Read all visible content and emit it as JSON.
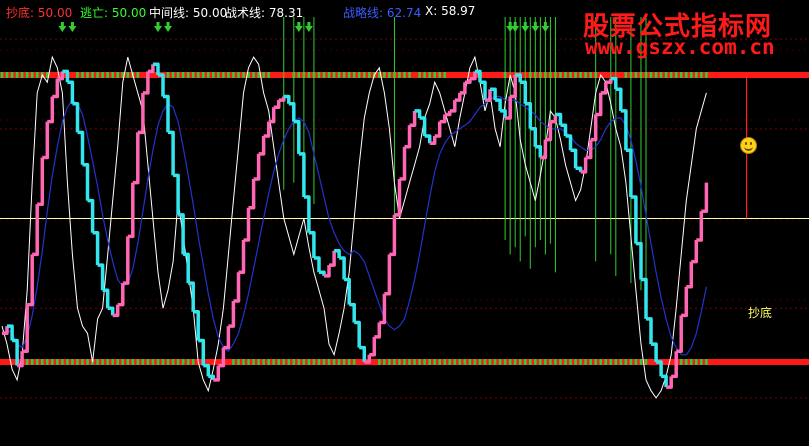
{
  "legend": {
    "chaodi": {
      "label": "抄底: ",
      "value": "50.00",
      "color": "#ff3030"
    },
    "taowang": {
      "label": "逃亡: ",
      "value": "50.00",
      "color": "#33ff33"
    },
    "zhongjian": {
      "label": "中间线: ",
      "value": "50.00",
      "color": "#ffffff"
    },
    "zhanshu": {
      "label": "战术线: ",
      "value": "78.31",
      "color": "#ffffff"
    },
    "zhanlue": {
      "label": "战略线: ",
      "value": "62.74",
      "color": "#3a5cff"
    },
    "x": {
      "label": "X: ",
      "value": "58.97",
      "color": "#ffffff"
    }
  },
  "watermark": {
    "line1": "股票公式指标网",
    "line2": "www.gszx.com.cn"
  },
  "annotation": {
    "text": "抄底",
    "color": "#ffff66"
  },
  "colors": {
    "tactical_up": "#ff66b3",
    "tactical_down": "#33e6ee",
    "strategic": "#2233cc",
    "x_line": "#ffffff",
    "band": "#ff1a1a",
    "band_green": "#33cc33",
    "middle": "#ffffaa",
    "signal_green": "#33cc33",
    "signal_red": "#ff2222"
  },
  "chart_data": {
    "type": "line",
    "ylim": [
      0,
      100
    ],
    "x_count": 161,
    "levels": {
      "top": 90,
      "middle": 50,
      "bottom": 10
    },
    "series": [
      {
        "name": "战术线",
        "values": [
          18,
          20,
          16,
          9,
          13,
          26,
          40,
          54,
          67,
          77,
          84,
          89,
          91,
          88,
          82,
          74,
          65,
          55,
          46,
          37,
          30,
          25,
          23,
          26,
          32,
          45,
          60,
          74,
          85,
          91,
          93,
          90,
          84,
          74,
          62,
          51,
          40,
          32,
          24,
          16,
          9,
          6,
          5,
          9,
          14,
          20,
          27,
          35,
          44,
          53,
          61,
          68,
          73,
          77,
          81,
          83,
          84,
          82,
          77,
          68,
          56,
          46,
          39,
          35,
          34,
          37,
          41,
          39,
          33,
          26,
          21,
          14,
          10,
          12,
          17,
          21,
          29,
          40,
          51,
          61,
          70,
          76,
          80,
          78,
          73,
          71,
          73,
          77,
          79,
          80,
          83,
          85,
          88,
          89,
          91,
          88,
          83,
          86,
          83,
          80,
          78,
          84,
          90,
          88,
          82,
          75,
          70,
          67,
          72,
          77,
          79,
          76,
          73,
          69,
          64,
          63,
          67,
          72,
          79,
          85,
          88,
          89,
          86,
          80,
          69,
          56,
          43,
          33,
          22,
          15,
          10,
          6,
          3,
          6,
          13,
          23,
          31,
          38,
          44,
          52,
          60
        ]
      },
      {
        "name": "战略线",
        "values": [
          18,
          19,
          18,
          15,
          14,
          17,
          23,
          31,
          41,
          52,
          62,
          70,
          77,
          81,
          83,
          82,
          79,
          73,
          66,
          59,
          51,
          44,
          38,
          33,
          31,
          32,
          36,
          43,
          52,
          61,
          69,
          76,
          80,
          82,
          81,
          77,
          70,
          62,
          54,
          45,
          37,
          29,
          22,
          17,
          14,
          13,
          15,
          18,
          23,
          29,
          36,
          43,
          50,
          57,
          63,
          68,
          72,
          75,
          77,
          78,
          77,
          74,
          68,
          62,
          56,
          50,
          46,
          43,
          41,
          40,
          41,
          40,
          38,
          34,
          30,
          26,
          22,
          20,
          19,
          20,
          22,
          27,
          33,
          40,
          48,
          56,
          63,
          68,
          71,
          73,
          74,
          75,
          76,
          77,
          79,
          81,
          82,
          83,
          84,
          84,
          83,
          83,
          83,
          82,
          81,
          80,
          79,
          77,
          76,
          75,
          75,
          75,
          74,
          73,
          71,
          70,
          69,
          69,
          70,
          72,
          75,
          77,
          78,
          78,
          76,
          72,
          66,
          59,
          51,
          43,
          35,
          28,
          22,
          17,
          14,
          12,
          12,
          14,
          18,
          24,
          31
        ]
      },
      {
        "name": "X",
        "values": [
          20,
          15,
          8,
          5,
          12,
          30,
          60,
          85,
          90,
          88,
          95,
          92,
          85,
          60,
          40,
          25,
          20,
          18,
          10,
          22,
          25,
          40,
          55,
          70,
          88,
          95,
          90,
          85,
          80,
          65,
          50,
          35,
          25,
          30,
          38,
          55,
          45,
          35,
          25,
          10,
          5,
          2,
          8,
          15,
          25,
          40,
          55,
          70,
          85,
          92,
          95,
          93,
          85,
          80,
          70,
          60,
          50,
          45,
          40,
          45,
          50,
          42,
          35,
          30,
          25,
          15,
          12,
          18,
          25,
          35,
          50,
          65,
          78,
          85,
          90,
          92,
          85,
          75,
          60,
          50,
          55,
          60,
          65,
          70,
          78,
          82,
          88,
          85,
          80,
          75,
          70,
          78,
          85,
          92,
          95,
          88,
          80,
          85,
          75,
          70,
          82,
          90,
          85,
          72,
          65,
          60,
          55,
          62,
          70,
          80,
          78,
          72,
          65,
          60,
          55,
          58,
          65,
          75,
          85,
          90,
          88,
          82,
          75,
          70,
          60,
          45,
          30,
          15,
          5,
          2,
          0,
          2,
          6,
          12,
          25,
          40,
          55,
          65,
          75,
          80,
          85
        ]
      }
    ],
    "signals": {
      "top_markers": [
        12,
        14,
        31,
        33,
        59,
        61,
        101,
        102,
        104,
        106,
        108
      ],
      "green_spikes": [
        [
          56,
          88
        ],
        [
          58,
          90
        ],
        [
          60,
          86
        ],
        [
          62,
          84
        ],
        [
          78,
          70
        ],
        [
          100,
          74
        ],
        [
          101,
          70
        ],
        [
          102,
          72
        ],
        [
          103,
          68
        ],
        [
          104,
          75
        ],
        [
          105,
          66
        ],
        [
          106,
          72
        ],
        [
          107,
          74
        ],
        [
          108,
          70
        ],
        [
          109,
          73
        ],
        [
          110,
          65
        ],
        [
          118,
          68
        ],
        [
          121,
          70
        ],
        [
          122,
          64
        ],
        [
          125,
          62
        ],
        [
          127,
          60
        ],
        [
          128,
          58
        ]
      ],
      "red_spikes": [
        [
          148,
          50
        ]
      ]
    }
  }
}
